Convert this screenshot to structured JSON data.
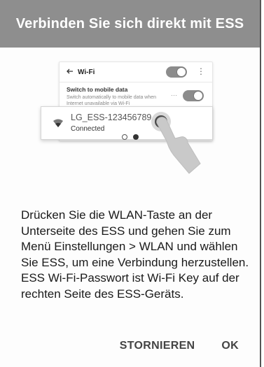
{
  "dialog": {
    "title": "Verbinden Sie sich direkt mit ESS",
    "message": "Drücken Sie die WLAN-Taste an der Unterseite des ESS und gehen Sie zum Menü Einstellungen > WLAN und wählen Sie ESS, um eine Verbindung herzustellen. ESS Wi-Fi-Passwort ist Wi-Fi Key auf der rechten Seite des ESS-Geräts.",
    "buttons": {
      "cancel_label": "STORNIEREN",
      "ok_label": "OK"
    }
  },
  "illustration": {
    "wifi_title": "Wi-Fi",
    "wifi_toggle_on": true,
    "mobile_data_title": "Switch to mobile data",
    "mobile_data_desc": "Switch automatically to mobile data when Internet unavailable via Wi-Fi",
    "mobile_data_toggle_on": true,
    "network_name": "LG_ESS-123456789...",
    "network_status": "Connected",
    "icons": [
      "back-arrow-icon",
      "more-vert-icon",
      "wifi-icon",
      "hand-pointer-icon"
    ]
  },
  "pager": {
    "total": 2,
    "active_index": 1
  },
  "colors": {
    "title_bar": "#8e8e8e",
    "title_text": "#ffffff",
    "button_text": "#444444"
  }
}
